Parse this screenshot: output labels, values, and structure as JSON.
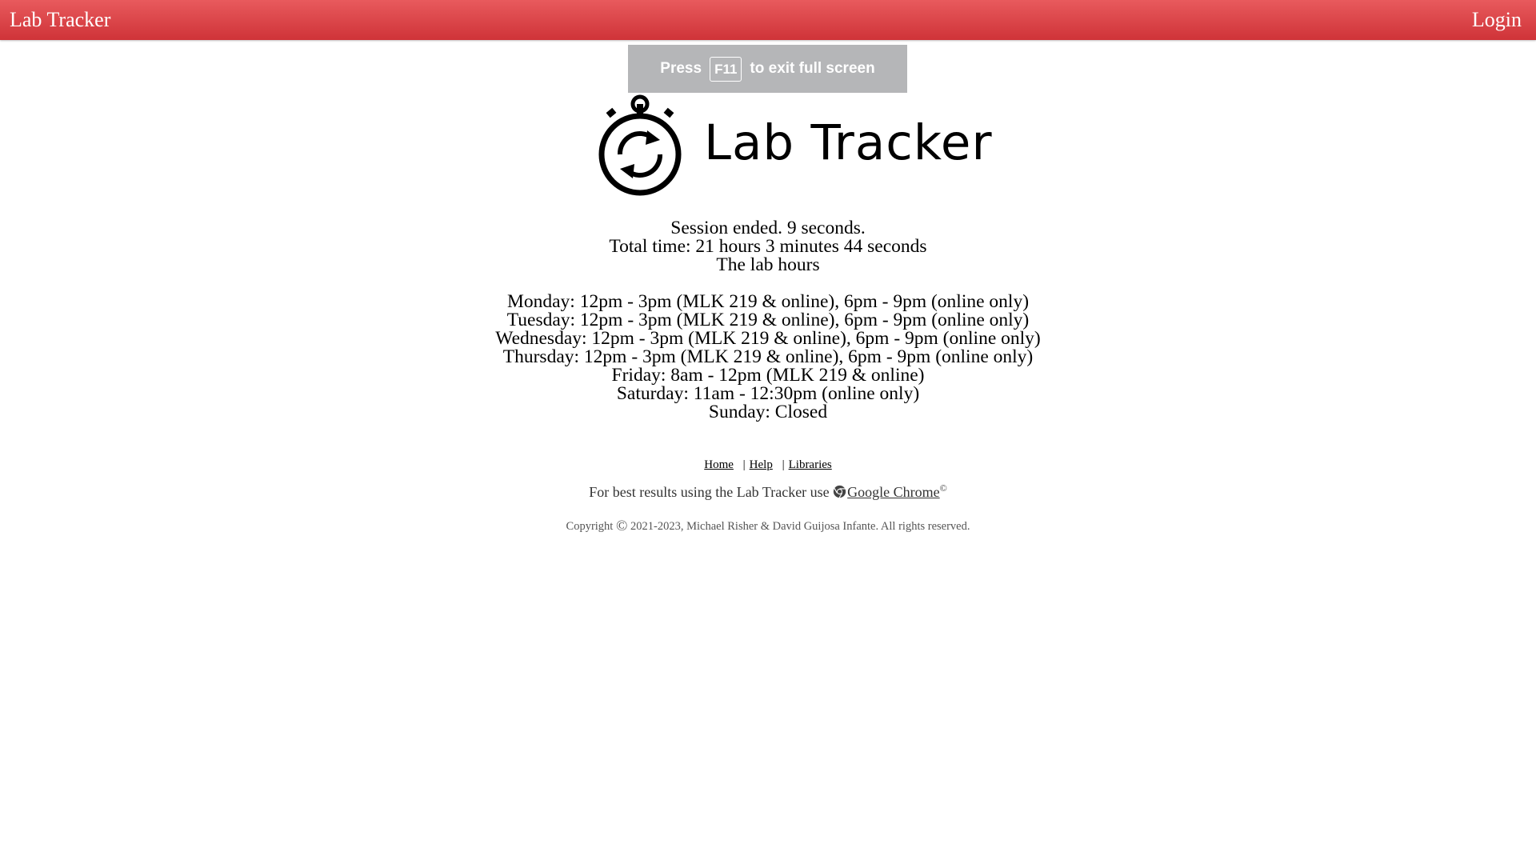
{
  "navbar": {
    "brand": "Lab Tracker",
    "login_label": "Login",
    "color": "#d9403f"
  },
  "fullscreen_toast": {
    "press": "Press",
    "key": "F11",
    "message": "to exit full screen"
  },
  "logo": {
    "text": "Lab Tracker",
    "icon": "stopwatch-icon"
  },
  "session": {
    "ended": "Session ended. 9 seconds.",
    "total": "Total time: 21 hours 3 minutes 44 seconds",
    "hours_title": "The lab hours"
  },
  "hours": [
    "Monday: 12pm - 3pm (MLK 219 & online), 6pm - 9pm (online only)",
    "Tuesday: 12pm - 3pm (MLK 219 & online), 6pm - 9pm (online only)",
    "Wednesday: 12pm - 3pm (MLK 219 & online), 6pm - 9pm (online only)",
    "Thursday: 12pm - 3pm (MLK 219 & online), 6pm - 9pm (online only)",
    "Friday: 8am - 12pm (MLK 219 & online)",
    "Saturday: 11am - 12:30pm (online only)",
    "Sunday: Closed"
  ],
  "footer": {
    "links": [
      "Home",
      "Help",
      "Libraries"
    ],
    "separator": "|",
    "best_results": "For best results using the Lab Tracker use ",
    "chrome_label": "Google Chrome",
    "chrome_sup": "©",
    "copyright_prefix": "Copyright",
    "copyright_symbol": "©",
    "copyright_text": " 2021-2023, Michael Risher & David Guijosa Infante. All rights reserved."
  }
}
